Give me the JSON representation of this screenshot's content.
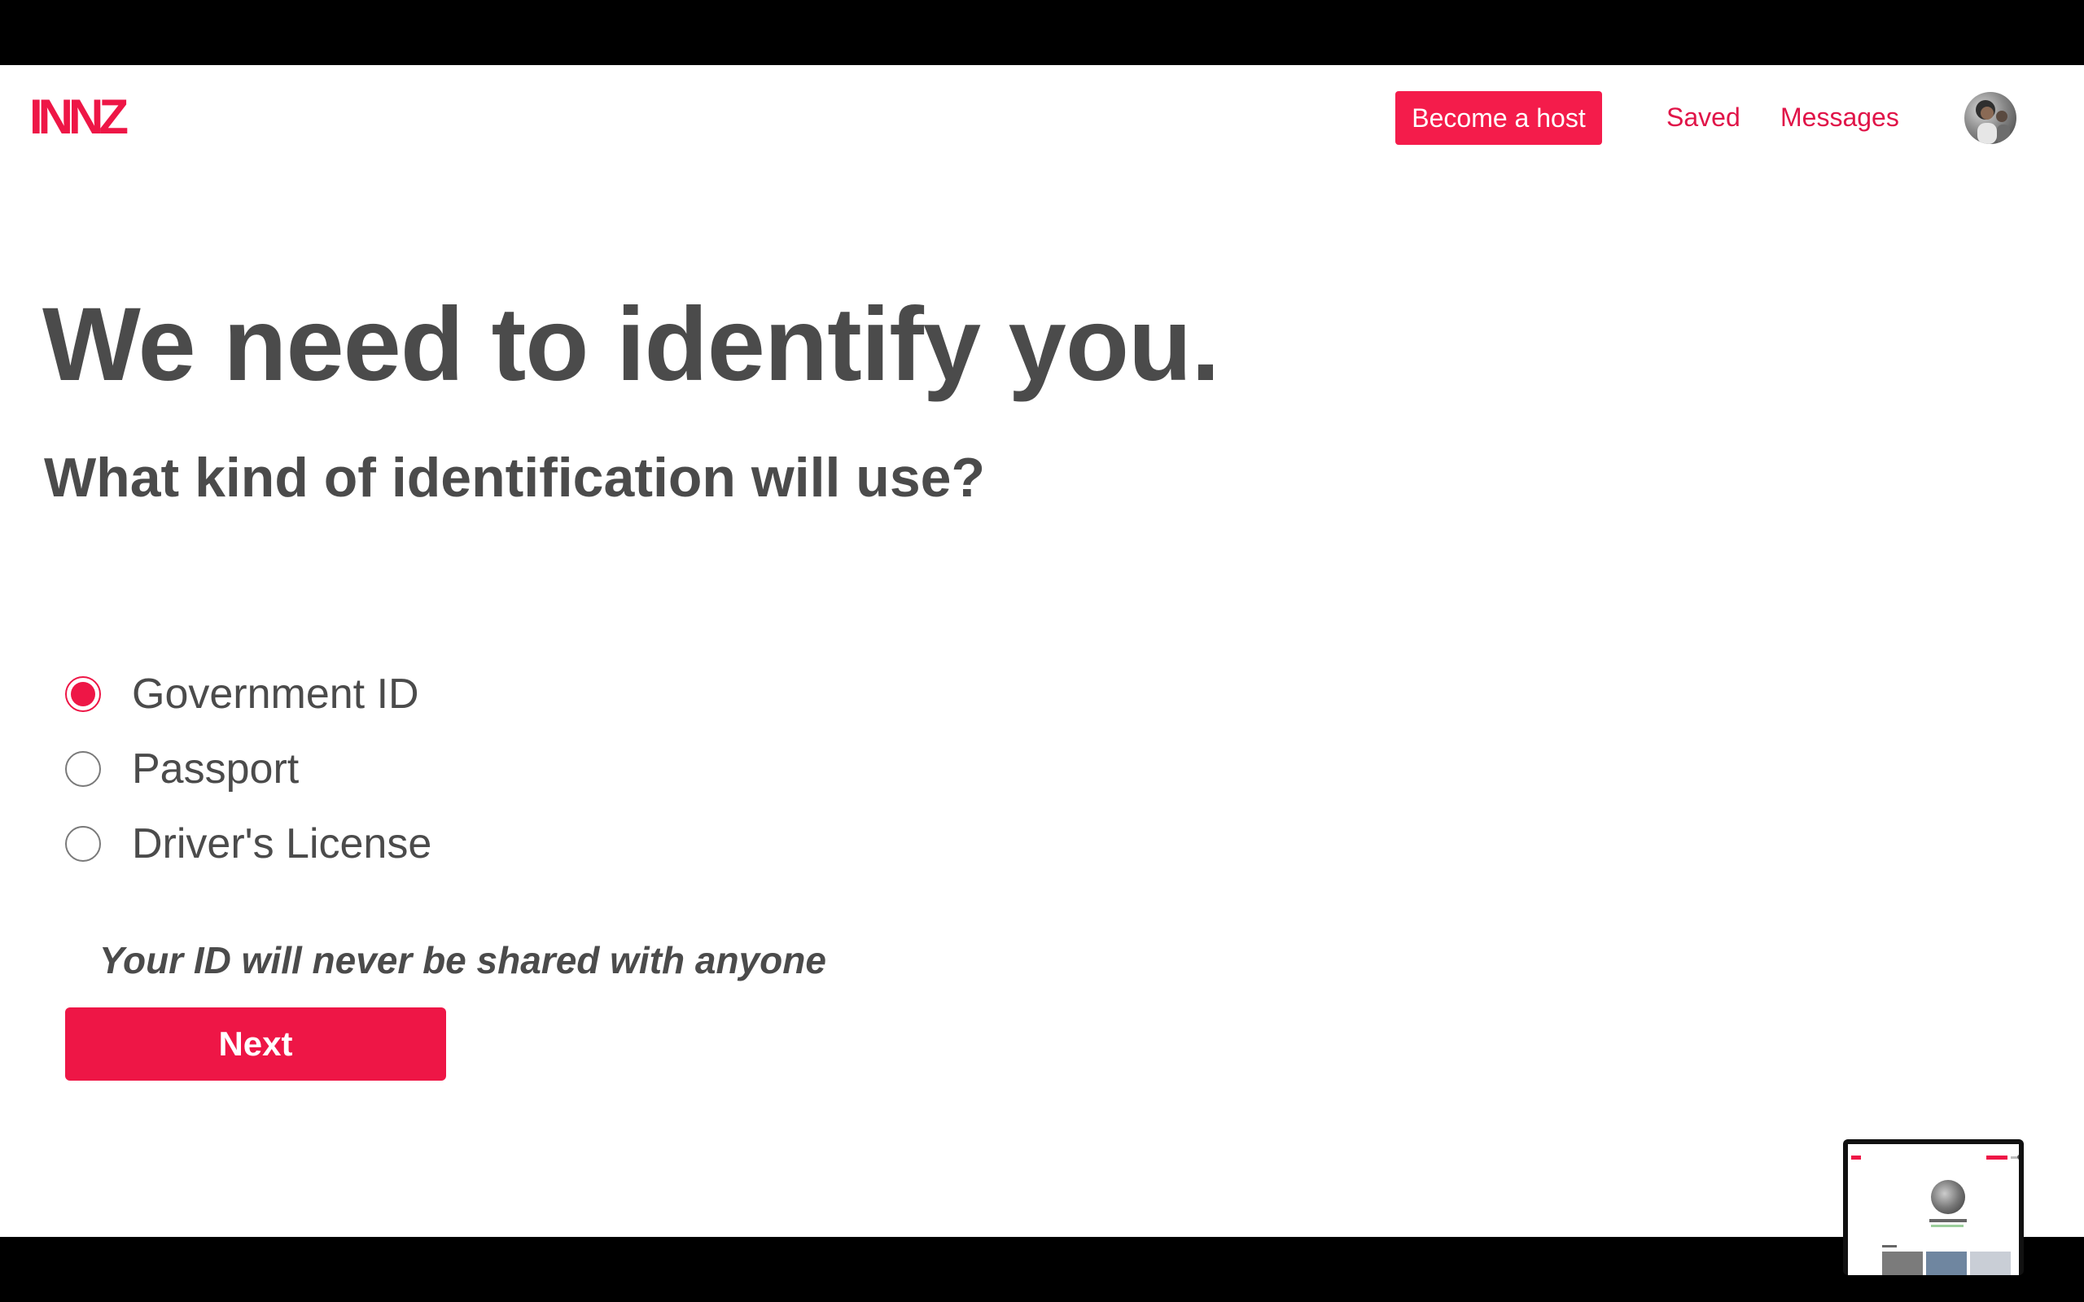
{
  "header": {
    "logo": "INNZ",
    "become_host": "Become a host",
    "saved": "Saved",
    "messages": "Messages",
    "avatar_icon": "user-avatar"
  },
  "main": {
    "headline": "We need to identify you.",
    "subheadline": "What kind of identification will use?",
    "options": [
      {
        "label": "Government ID",
        "selected": true
      },
      {
        "label": "Passport",
        "selected": false
      },
      {
        "label": "Driver's License",
        "selected": false
      }
    ],
    "note": "Your ID will never be shared with anyone",
    "next_label": "Next"
  },
  "colors": {
    "accent": "#ee1646",
    "text": "#4b4b4b"
  }
}
